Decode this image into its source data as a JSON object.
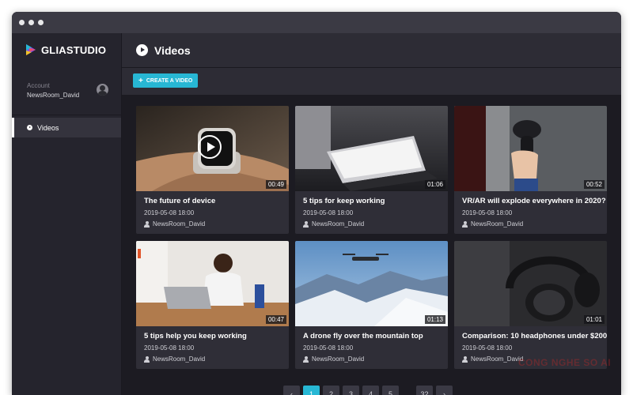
{
  "app": {
    "name": "GLIASTUDIO",
    "accent_color": "#27b7d4"
  },
  "account": {
    "label": "Account",
    "name": "NewsRoom_David"
  },
  "sidebar": {
    "items": [
      {
        "label": "Videos",
        "icon": "play-circle-icon",
        "active": true
      }
    ]
  },
  "header": {
    "title": "Videos",
    "icon": "play-circle-icon"
  },
  "toolbar": {
    "create_label": "CREATE A VIDEO"
  },
  "videos": [
    {
      "title": "The future of device",
      "date": "2019-05-08  18:00",
      "author": "NewsRoom_David",
      "duration": "00:49",
      "thumb": "smartwatch-on-wrist"
    },
    {
      "title": "5 tips for keep working",
      "date": "2019-05-08  18:00",
      "author": "NewsRoom_David",
      "duration": "01:06",
      "thumb": "laptop-on-desk"
    },
    {
      "title": "VR/AR will explode everywhere in 2020?",
      "date": "2019-05-08  18:00",
      "author": "NewsRoom_David",
      "duration": "00:52",
      "thumb": "vr-controller-in-hand"
    },
    {
      "title": "5 tips help you keep working",
      "date": "2019-05-08  18:00",
      "author": "NewsRoom_David",
      "duration": "00:47",
      "thumb": "man-working-on-laptop"
    },
    {
      "title": "A drone fly over the mountain top",
      "date": "2019-05-08  18:00",
      "author": "NewsRoom_David",
      "duration": "01:13",
      "thumb": "drone-over-snowy-mountains"
    },
    {
      "title": "Comparison: 10 headphones under $200",
      "date": "2019-05-08  18:00",
      "author": "NewsRoom_David",
      "duration": "01:01",
      "thumb": "headphones-close-up"
    }
  ],
  "pagination": {
    "prev": "‹",
    "pages": [
      "1",
      "2",
      "3",
      "4",
      "5"
    ],
    "ellipsis": "...",
    "last": "32",
    "next": "›",
    "current": "1"
  },
  "watermark": "CONG NGHE SO AI"
}
